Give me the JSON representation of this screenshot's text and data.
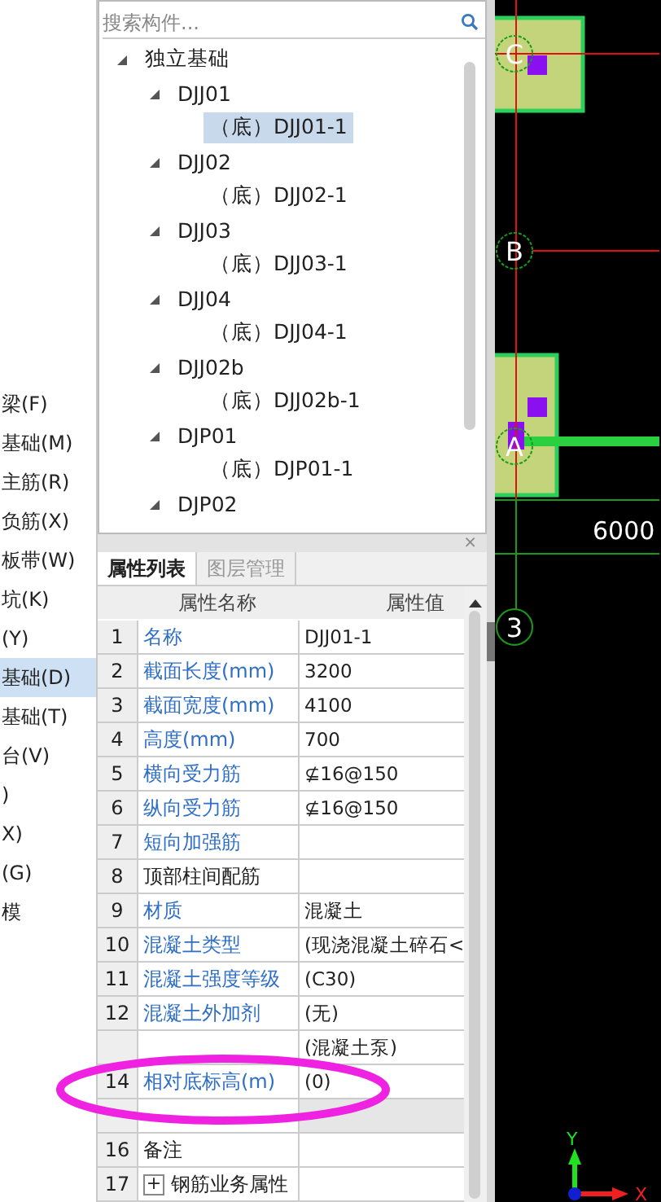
{
  "side_list": [
    {
      "label": "梁(F)",
      "selected": false
    },
    {
      "label": "基础(M)",
      "selected": false
    },
    {
      "label": "主筋(R)",
      "selected": false
    },
    {
      "label": "负筋(X)",
      "selected": false
    },
    {
      "label": "板带(W)",
      "selected": false
    },
    {
      "label": "坑(K)",
      "selected": false
    },
    {
      "label": "(Y)",
      "selected": false
    },
    {
      "label": "基础(D)",
      "selected": true
    },
    {
      "label": "基础(T)",
      "selected": false
    },
    {
      "label": "台(V)",
      "selected": false
    },
    {
      "label": ")",
      "selected": false
    },
    {
      "label": "X)",
      "selected": false
    },
    {
      "label": "(G)",
      "selected": false
    },
    {
      "label": "模",
      "selected": false
    }
  ],
  "search": {
    "placeholder": "搜索构件..."
  },
  "tree": [
    {
      "label": "独立基础",
      "expanded": true,
      "selected": false,
      "children": [
        {
          "label": "DJJ01",
          "expanded": true,
          "selected": false,
          "children": [
            {
              "label": "（底）DJJ01-1",
              "selected": true
            }
          ]
        },
        {
          "label": "DJJ02",
          "expanded": true,
          "selected": false,
          "children": [
            {
              "label": "（底）DJJ02-1",
              "selected": false
            }
          ]
        },
        {
          "label": "DJJ03",
          "expanded": true,
          "selected": false,
          "children": [
            {
              "label": "（底）DJJ03-1",
              "selected": false
            }
          ]
        },
        {
          "label": "DJJ04",
          "expanded": true,
          "selected": false,
          "children": [
            {
              "label": "（底）DJJ04-1",
              "selected": false
            }
          ]
        },
        {
          "label": "DJJ02b",
          "expanded": true,
          "selected": false,
          "children": [
            {
              "label": "（底）DJJ02b-1",
              "selected": false
            }
          ]
        },
        {
          "label": "DJP01",
          "expanded": true,
          "selected": false,
          "children": [
            {
              "label": "（底）DJP01-1",
              "selected": false
            }
          ]
        },
        {
          "label": "DJP02",
          "expanded": true,
          "selected": false
        }
      ]
    }
  ],
  "props_panel": {
    "close": "×",
    "tabs": [
      {
        "label": "属性列表",
        "selected": true
      },
      {
        "label": "图层管理",
        "selected": false
      }
    ],
    "columns": [
      "属性名称",
      "属性值"
    ],
    "rows": [
      {
        "num": "1",
        "name": "名称",
        "value": "DJJ01-1",
        "public": true,
        "disabled": false
      },
      {
        "num": "2",
        "name": "截面长度(mm)",
        "value": "3200",
        "public": true,
        "disabled": false
      },
      {
        "num": "3",
        "name": "截面宽度(mm)",
        "value": "4100",
        "public": true,
        "disabled": false
      },
      {
        "num": "4",
        "name": "高度(mm)",
        "value": "700",
        "public": true,
        "disabled": false
      },
      {
        "num": "5",
        "name": "横向受力筋",
        "value": "⊈16@150",
        "public": true,
        "disabled": false
      },
      {
        "num": "6",
        "name": "纵向受力筋",
        "value": "⊈16@150",
        "public": true,
        "disabled": false
      },
      {
        "num": "7",
        "name": "短向加强筋",
        "public": true,
        "disabled": false
      },
      {
        "num": "8",
        "name": "顶部柱间配筋",
        "public": false,
        "disabled": false
      },
      {
        "num": "9",
        "name": "材质",
        "value": "混凝土",
        "public": true,
        "disabled": false
      },
      {
        "num": "10",
        "name": "混凝土类型",
        "value": "(现浇混凝土碎石<",
        "public": true,
        "disabled": false
      },
      {
        "num": "11",
        "name": "混凝土强度等级",
        "value": "(C30)",
        "public": true,
        "disabled": false
      },
      {
        "num": "12",
        "name": "混凝土外加剂",
        "value": "(无)",
        "public": true,
        "disabled": false
      },
      {
        "value": "(混凝土泵)",
        "disabled": false
      },
      {
        "num": "14",
        "name": "相对底标高(m)",
        "value": "(0)",
        "public": true,
        "disabled": false
      },
      {
        "disabled": true
      },
      {
        "num": "16",
        "name": "备注",
        "public": false,
        "disabled": false
      },
      {
        "num": "17",
        "name": "钢筋业务属性",
        "public": false,
        "disabled": false,
        "expander": "+"
      }
    ]
  },
  "canvas": {
    "axis_labels": [
      "C",
      "B",
      "A",
      "3"
    ],
    "dimension": "6000",
    "x_label": "X",
    "y_label": "Y"
  }
}
